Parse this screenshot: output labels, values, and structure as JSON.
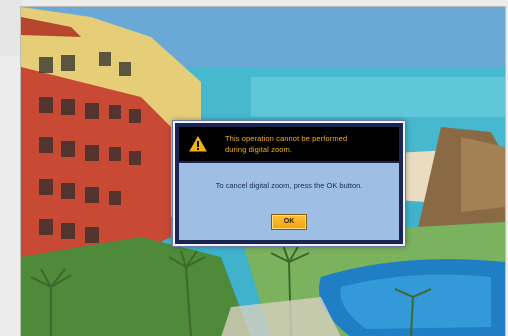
{
  "dialog": {
    "warning_icon": "warning-triangle-icon",
    "message_line1": "This operation cannot be performed",
    "message_line2": "during digital zoom.",
    "instruction": "To cancel digital zoom, press the OK button.",
    "ok_label": "OK",
    "colors": {
      "header_bg": "#000000",
      "header_text": "#f3b318",
      "body_bg": "#9fbee6",
      "button": "#f6ad1c"
    }
  }
}
